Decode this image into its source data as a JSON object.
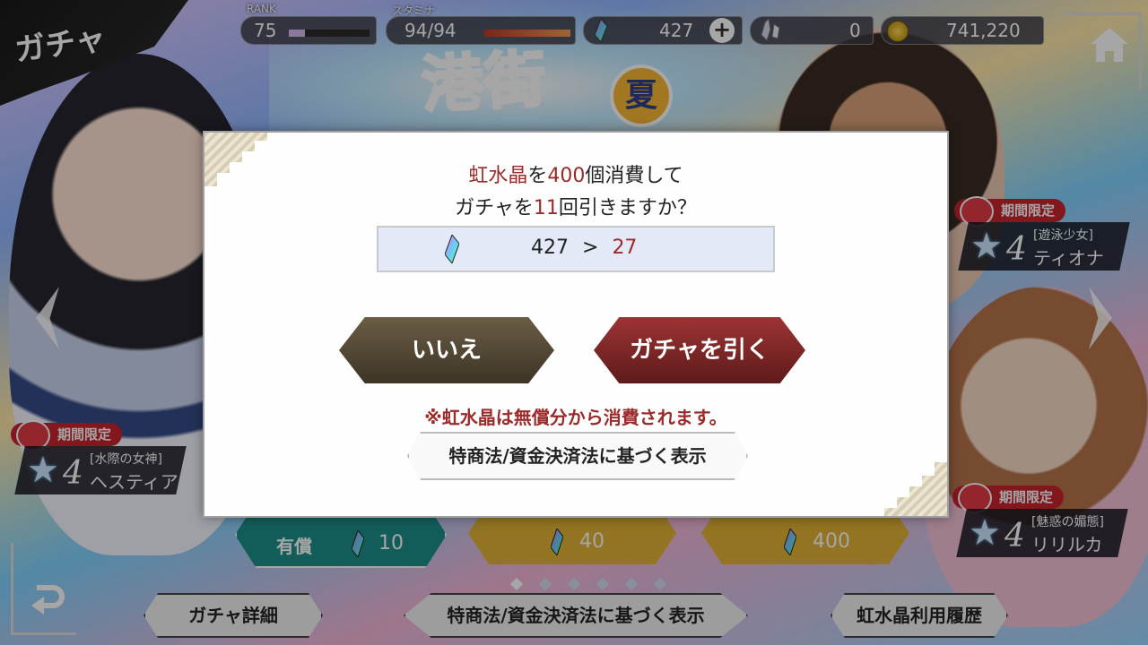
{
  "header": {
    "title": "ガチャ",
    "rank": {
      "label": "RANK",
      "value": "75",
      "progress": 0.2
    },
    "stamina": {
      "label": "スタミナ",
      "value": "94/94",
      "progress": 1.0
    },
    "crystals": {
      "value": "427",
      "plus": "+"
    },
    "crystal_fragments": {
      "value": "0"
    },
    "gold": {
      "value": "741,220"
    }
  },
  "banner": {
    "logo_text": "港街",
    "season_badge": "夏"
  },
  "characters": [
    {
      "limited": "期間限定",
      "rarity": "4",
      "title": "[水際の女神]",
      "name": "ヘスティア"
    },
    {
      "limited": "期間限定",
      "rarity": "4",
      "title": "[遊泳少女]",
      "name": "ティオナ"
    },
    {
      "limited": "期間限定",
      "rarity": "4",
      "title": "[魅惑の媚態]",
      "name": "リリルカ"
    }
  ],
  "gacha_buttons": [
    {
      "sub": "有償",
      "cost": "10"
    },
    {
      "cost": "40"
    },
    {
      "cost": "400"
    }
  ],
  "footer": {
    "details": "ガチャ詳細",
    "legal": "特商法/資金決済法に基づく表示",
    "history": "虹水晶利用履歴"
  },
  "dialog": {
    "line1_item": "虹水晶",
    "line1_mid": "を",
    "line1_count": "400",
    "line1_end": "個消費して",
    "line2_start": "ガチャを",
    "line2_count": "11",
    "line2_end": "回引きますか？",
    "balance_before": "427",
    "arrow": ">",
    "balance_after": "27",
    "no_button": "いいえ",
    "yes_button": "ガチャを引く",
    "notice": "※虹水晶は無償分から消費されます。",
    "legal_button": "特商法/資金決済法に基づく表示"
  },
  "colors": {
    "accent_red": "#9b2a2a",
    "button_no": "#4e4433",
    "button_yes": "#7a2424"
  }
}
